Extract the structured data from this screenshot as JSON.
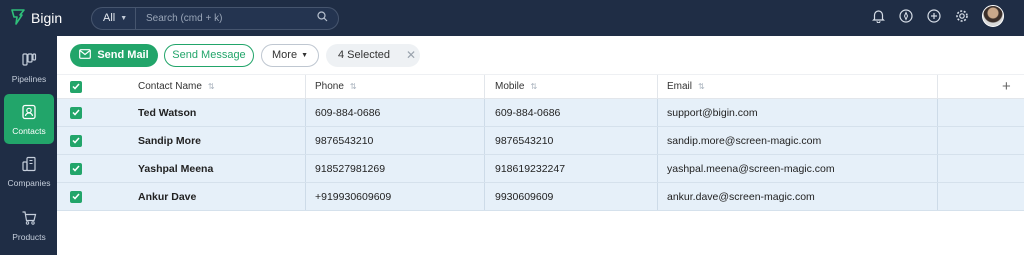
{
  "app": {
    "name": "Bigin"
  },
  "search": {
    "scope": "All",
    "placeholder": "Search (cmd + k)"
  },
  "top_icons": [
    "bell-icon",
    "compass-icon",
    "plus-circle-icon",
    "gear-icon"
  ],
  "sidebar": {
    "items": [
      {
        "label": "Pipelines",
        "icon": "pipelines-icon",
        "active": false
      },
      {
        "label": "Contacts",
        "icon": "contacts-icon",
        "active": true
      },
      {
        "label": "Companies",
        "icon": "companies-icon",
        "active": false
      },
      {
        "label": "Products",
        "icon": "products-icon",
        "active": false
      }
    ]
  },
  "toolbar": {
    "send_mail": "Send Mail",
    "send_message": "Send Message",
    "more": "More",
    "selected": "4 Selected"
  },
  "table": {
    "columns": [
      "Contact Name",
      "Phone",
      "Mobile",
      "Email"
    ],
    "rows": [
      {
        "name": "Ted Watson",
        "phone": "609-884-0686",
        "mobile": "609-884-0686",
        "email": "support@bigin.com",
        "checked": true
      },
      {
        "name": "Sandip More",
        "phone": "9876543210",
        "mobile": "9876543210",
        "email": "sandip.more@screen-magic.com",
        "checked": true
      },
      {
        "name": "Yashpal Meena",
        "phone": "918527981269",
        "mobile": "918619232247",
        "email": "yashpal.meena@screen-magic.com",
        "checked": true
      },
      {
        "name": "Ankur Dave",
        "phone": "+919930609609",
        "mobile": "9930609609",
        "email": "ankur.dave@screen-magic.com",
        "checked": true
      }
    ]
  },
  "colors": {
    "topbar": "#1f2d45",
    "accent": "#22a56a",
    "row_selected": "#e6f0f9"
  }
}
